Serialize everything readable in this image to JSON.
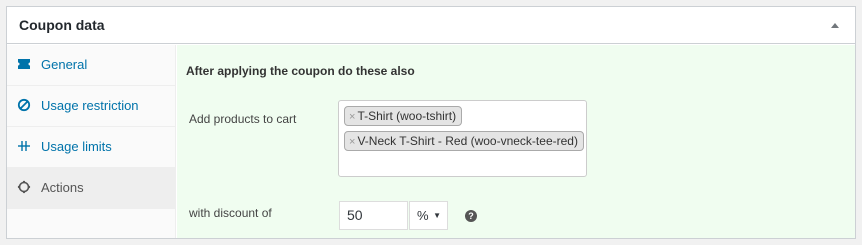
{
  "panel": {
    "title": "Coupon data"
  },
  "tabs": [
    {
      "label": "General",
      "icon": "ticket-icon"
    },
    {
      "label": "Usage restriction",
      "icon": "block-icon"
    },
    {
      "label": "Usage limits",
      "icon": "limits-icon"
    },
    {
      "label": "Actions",
      "icon": "gear-icon",
      "active": true
    }
  ],
  "content": {
    "section_title": "After applying the coupon do these also",
    "add_products": {
      "label": "Add products to cart",
      "remove_glyph": "×",
      "selected": [
        "T-Shirt (woo-tshirt)",
        "V-Neck T-Shirt - Red (woo-vneck-tee-red)"
      ]
    },
    "discount": {
      "label": "with discount of",
      "value": "50",
      "unit": "%",
      "caret": "▼",
      "help": "?"
    }
  },
  "colors": {
    "link": "#0073aa",
    "content_bg": "#f0fdf0",
    "active_tab_bg": "#eeeeee"
  }
}
